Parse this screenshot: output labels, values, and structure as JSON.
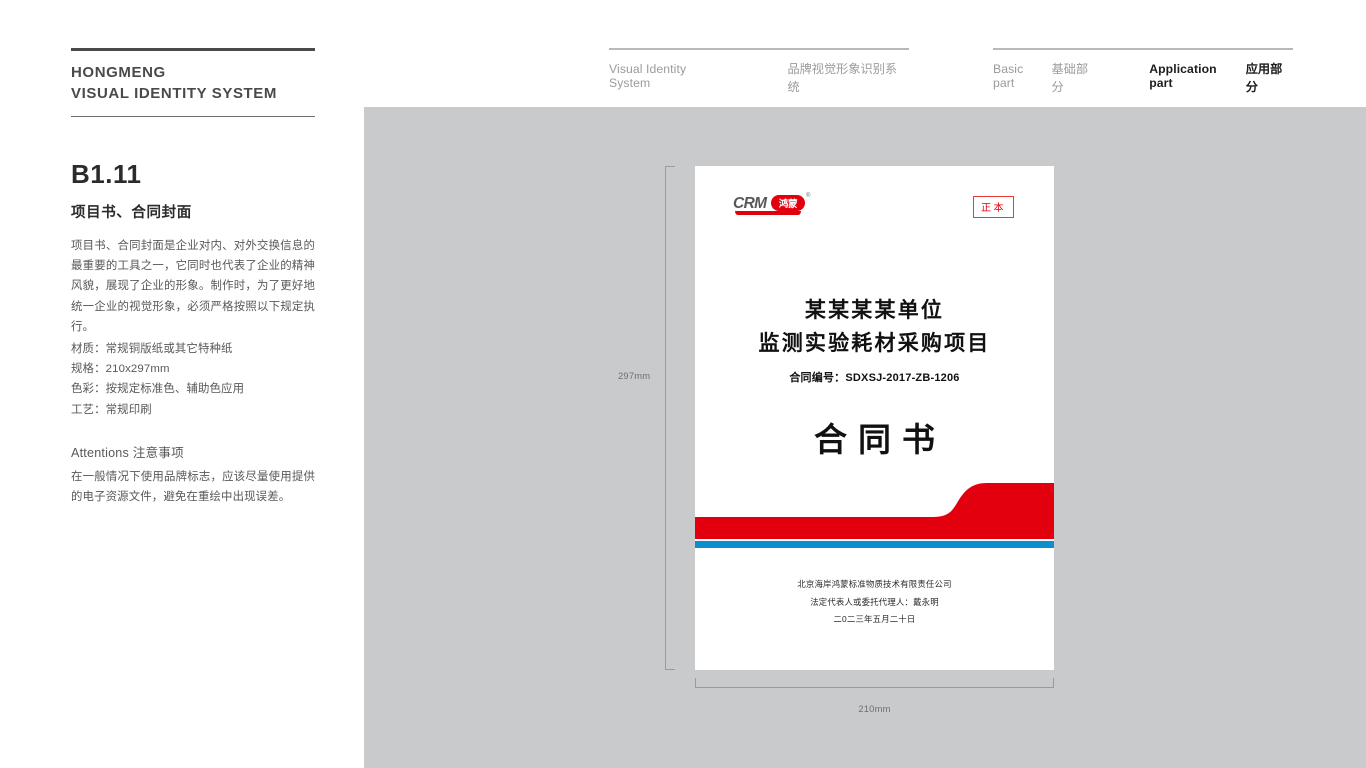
{
  "brand": {
    "line1": "HONGMENG",
    "line2": "VISUAL IDENTITY SYSTEM"
  },
  "nav": {
    "visual_en": "Visual Identity System",
    "visual_cn": "品牌视觉形象识别系统",
    "basic_en": "Basic part",
    "basic_cn": "基础部分",
    "application_en": "Application part",
    "application_cn": "应用部分"
  },
  "section": {
    "code": "B1.11",
    "title": "项目书、合同封面",
    "description": "项目书、合同封面是企业对内、对外交换信息的最重要的工具之一，它同时也代表了企业的精神风貌，展现了企业的形象。制作时，为了更好地统一企业的视觉形象，必须严格按照以下规定执行。",
    "specs": [
      "材质：常规铜版纸或其它特种纸",
      "规格：210x297mm",
      "色彩：按规定标准色、辅助色应用",
      "工艺：常规印刷"
    ],
    "attentions_heading": "Attentions 注意事项",
    "attentions_body": "在一般情况下使用品牌标志，应该尽量使用提供的电子资源文件，避免在重绘中出现误差。"
  },
  "mockup": {
    "dim_height": "297mm",
    "dim_width": "210mm",
    "logo": {
      "latin": "CRM",
      "chinese": "鸿蒙",
      "registered": "®"
    },
    "stamp": "正本",
    "heading_line1": "某某某某单位",
    "heading_line2": "监测实验耗材采购项目",
    "contract_number": "合同编号：SDXSJ-2017-ZB-1206",
    "document_title": "合同书",
    "footer": [
      "北京海岸鸿蒙标准物质技术有限责任公司",
      "法定代表人或委托代理人：戴永明",
      "二0二三年五月二十日"
    ]
  },
  "colors": {
    "brand_red": "#e2000f",
    "brand_blue": "#0d8ecf",
    "stage_gray": "#c9cacb",
    "text_gray": "#58585a"
  }
}
